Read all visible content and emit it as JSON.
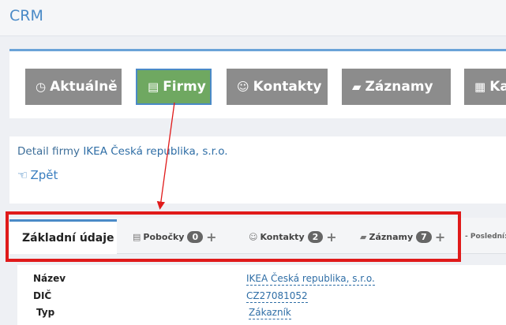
{
  "app": {
    "title": "CRM"
  },
  "nav": {
    "items": [
      {
        "label": "Aktuálně",
        "icon": "clock-icon"
      },
      {
        "label": "Firmy",
        "icon": "building-icon"
      },
      {
        "label": "Kontakty",
        "icon": "user-icon"
      },
      {
        "label": "Záznamy",
        "icon": "folder-open-icon"
      },
      {
        "label": "Kalendář",
        "icon": "calendar-icon"
      }
    ],
    "active": "Firmy"
  },
  "detail": {
    "prefix": "Detail firmy",
    "company": "IKEA Česká republika, s.r.o.",
    "back_label": "Zpět"
  },
  "tabs": {
    "items": [
      {
        "label": "Základní údaje"
      },
      {
        "label": "Pobočky",
        "count": "0"
      },
      {
        "label": "Kontakty",
        "count": "2"
      },
      {
        "label": "Záznamy",
        "count": "7"
      }
    ],
    "trailing_text": "- Poslední: "
  },
  "fields": [
    {
      "label": "Název",
      "value": "IKEA Česká republika, s.r.o."
    },
    {
      "label": "DIČ",
      "value": "CZ27081052"
    },
    {
      "label": "Typ",
      "value": "Zákazník"
    }
  ],
  "colors": {
    "brand": "#4a8ac7",
    "nav_button": "#8c8c8c",
    "nav_active": "#6fa861",
    "highlight": "#e01a1a"
  }
}
